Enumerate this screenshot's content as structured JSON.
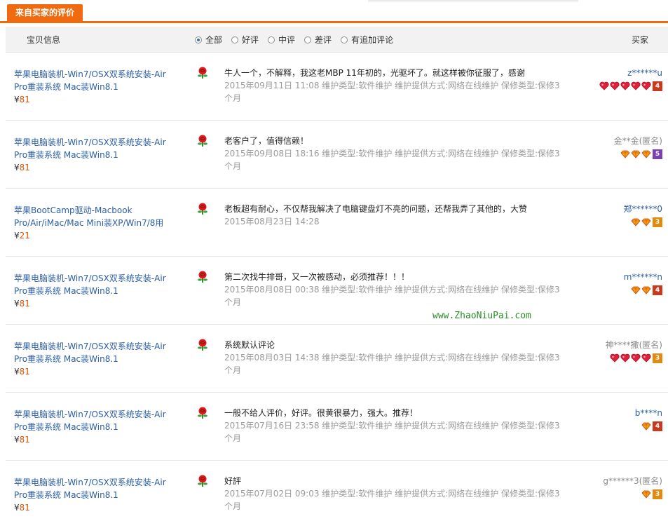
{
  "tab": {
    "label": "来自买家的评价"
  },
  "header": {
    "item_col": "宝贝信息",
    "buyer_col": "买家",
    "filters": [
      {
        "label": "全部",
        "selected": true
      },
      {
        "label": "好评",
        "selected": false
      },
      {
        "label": "中评",
        "selected": false
      },
      {
        "label": "差评",
        "selected": false
      },
      {
        "label": "有追加评论",
        "selected": false
      }
    ]
  },
  "colors": {
    "accent": "#f06a10",
    "link": "#2b5fa6",
    "price": "#e4550a",
    "meta": "#9a9a9a"
  },
  "reviews": [
    {
      "product_title": "苹果电脑装机-Win7/OSX双系统安装-Air Pro重装系统 Mac装Win8.1",
      "currency": "¥",
      "price": "81",
      "text": "牛人一个，不解释，我这老MBP 11年初的，光驱坏了。就这样被你征服了，感谢",
      "meta": "2015年09月11日 11:08 维护类型:软件维护  维护提供方式:网络在线维护  保修类型:保修3个月",
      "buyer": "z******u",
      "anonymous": false,
      "rank_icon": "heart",
      "rank_count": 5,
      "vip_level": "4",
      "vip_color": "#c8391e"
    },
    {
      "product_title": "苹果电脑装机-Win7/OSX双系统安装-Air Pro重装系统 Mac装Win8.1",
      "currency": "¥",
      "price": "81",
      "text": "老客户了，值得信赖！",
      "meta": "2015年09月08日 18:16 维护类型:软件维护  维护提供方式:网络在线维护  保修类型:保修3个月",
      "buyer": "金**金(匿名)",
      "anonymous": true,
      "rank_icon": "diamond",
      "rank_count": 3,
      "vip_level": "5",
      "vip_color": "#7b3fb5"
    },
    {
      "product_title": "苹果BootCamp驱动-Macbook Pro/Air/iMac/Mac Mini装XP/Win7/8用",
      "currency": "¥",
      "price": "21",
      "text": "老板超有耐心，不仅帮我解决了电脑键盘灯不亮的问题，还帮我弄了其他的，大赞",
      "meta": "2015年08月23日 14:28",
      "buyer": "郑******0",
      "anonymous": false,
      "rank_icon": "diamond",
      "rank_count": 2,
      "vip_level": "3",
      "vip_color": "#e08a10"
    },
    {
      "product_title": "苹果电脑装机-Win7/OSX双系统安装-Air Pro重装系统 Mac装Win8.1",
      "currency": "¥",
      "price": "81",
      "text": "第二次找牛排哥，又一次被感动，必须推荐！！！",
      "meta": "2015年08月08日 00:38 维护类型:软件维护  维护提供方式:网络在线维护  保修类型:保修3个月",
      "buyer": "m******n",
      "anonymous": false,
      "rank_icon": "diamond",
      "rank_count": 2,
      "vip_level": "4",
      "vip_color": "#c8391e"
    },
    {
      "product_title": "苹果电脑装机-Win7/OSX双系统安装-Air Pro重装系统 Mac装Win8.1",
      "currency": "¥",
      "price": "81",
      "text": "系统默认评论",
      "meta": "2015年08月03日 14:38 维护类型:软件维护  维护提供方式:网络在线维护  保修类型:保修3个月",
      "buyer": "神****撒(匿名)",
      "anonymous": true,
      "rank_icon": "heart",
      "rank_count": 4,
      "vip_level": "3",
      "vip_color": "#e08a10"
    },
    {
      "product_title": "苹果电脑装机-Win7/OSX双系统安装-Air Pro重装系统 Mac装Win8.1",
      "currency": "¥",
      "price": "81",
      "text": "一般不给人评价，好评。很黄很暴力，强大。推荐！",
      "meta": "2015年07月16日 23:58 维护类型:软件维护  维护提供方式:网络在线维护  保修类型:保修3个月",
      "buyer": "b****n",
      "anonymous": false,
      "rank_icon": "diamond",
      "rank_count": 1,
      "vip_level": "4",
      "vip_color": "#c8391e"
    },
    {
      "product_title": "苹果电脑装机-Win7/OSX双系统安装-Air Pro重装系统 Mac装Win8.1",
      "currency": "¥",
      "price": "81",
      "text": "好評",
      "meta": "2015年07月02日 09:03 维护类型:软件维护  维护提供方式:网络在线维护  保修类型:保修3个月",
      "buyer": "g******3(匿名)",
      "anonymous": true,
      "rank_icon": "diamond",
      "rank_count": 1,
      "vip_level": "3",
      "vip_color": "#e08a10"
    }
  ],
  "watermark": "www.ZhaoNiuPai.com"
}
